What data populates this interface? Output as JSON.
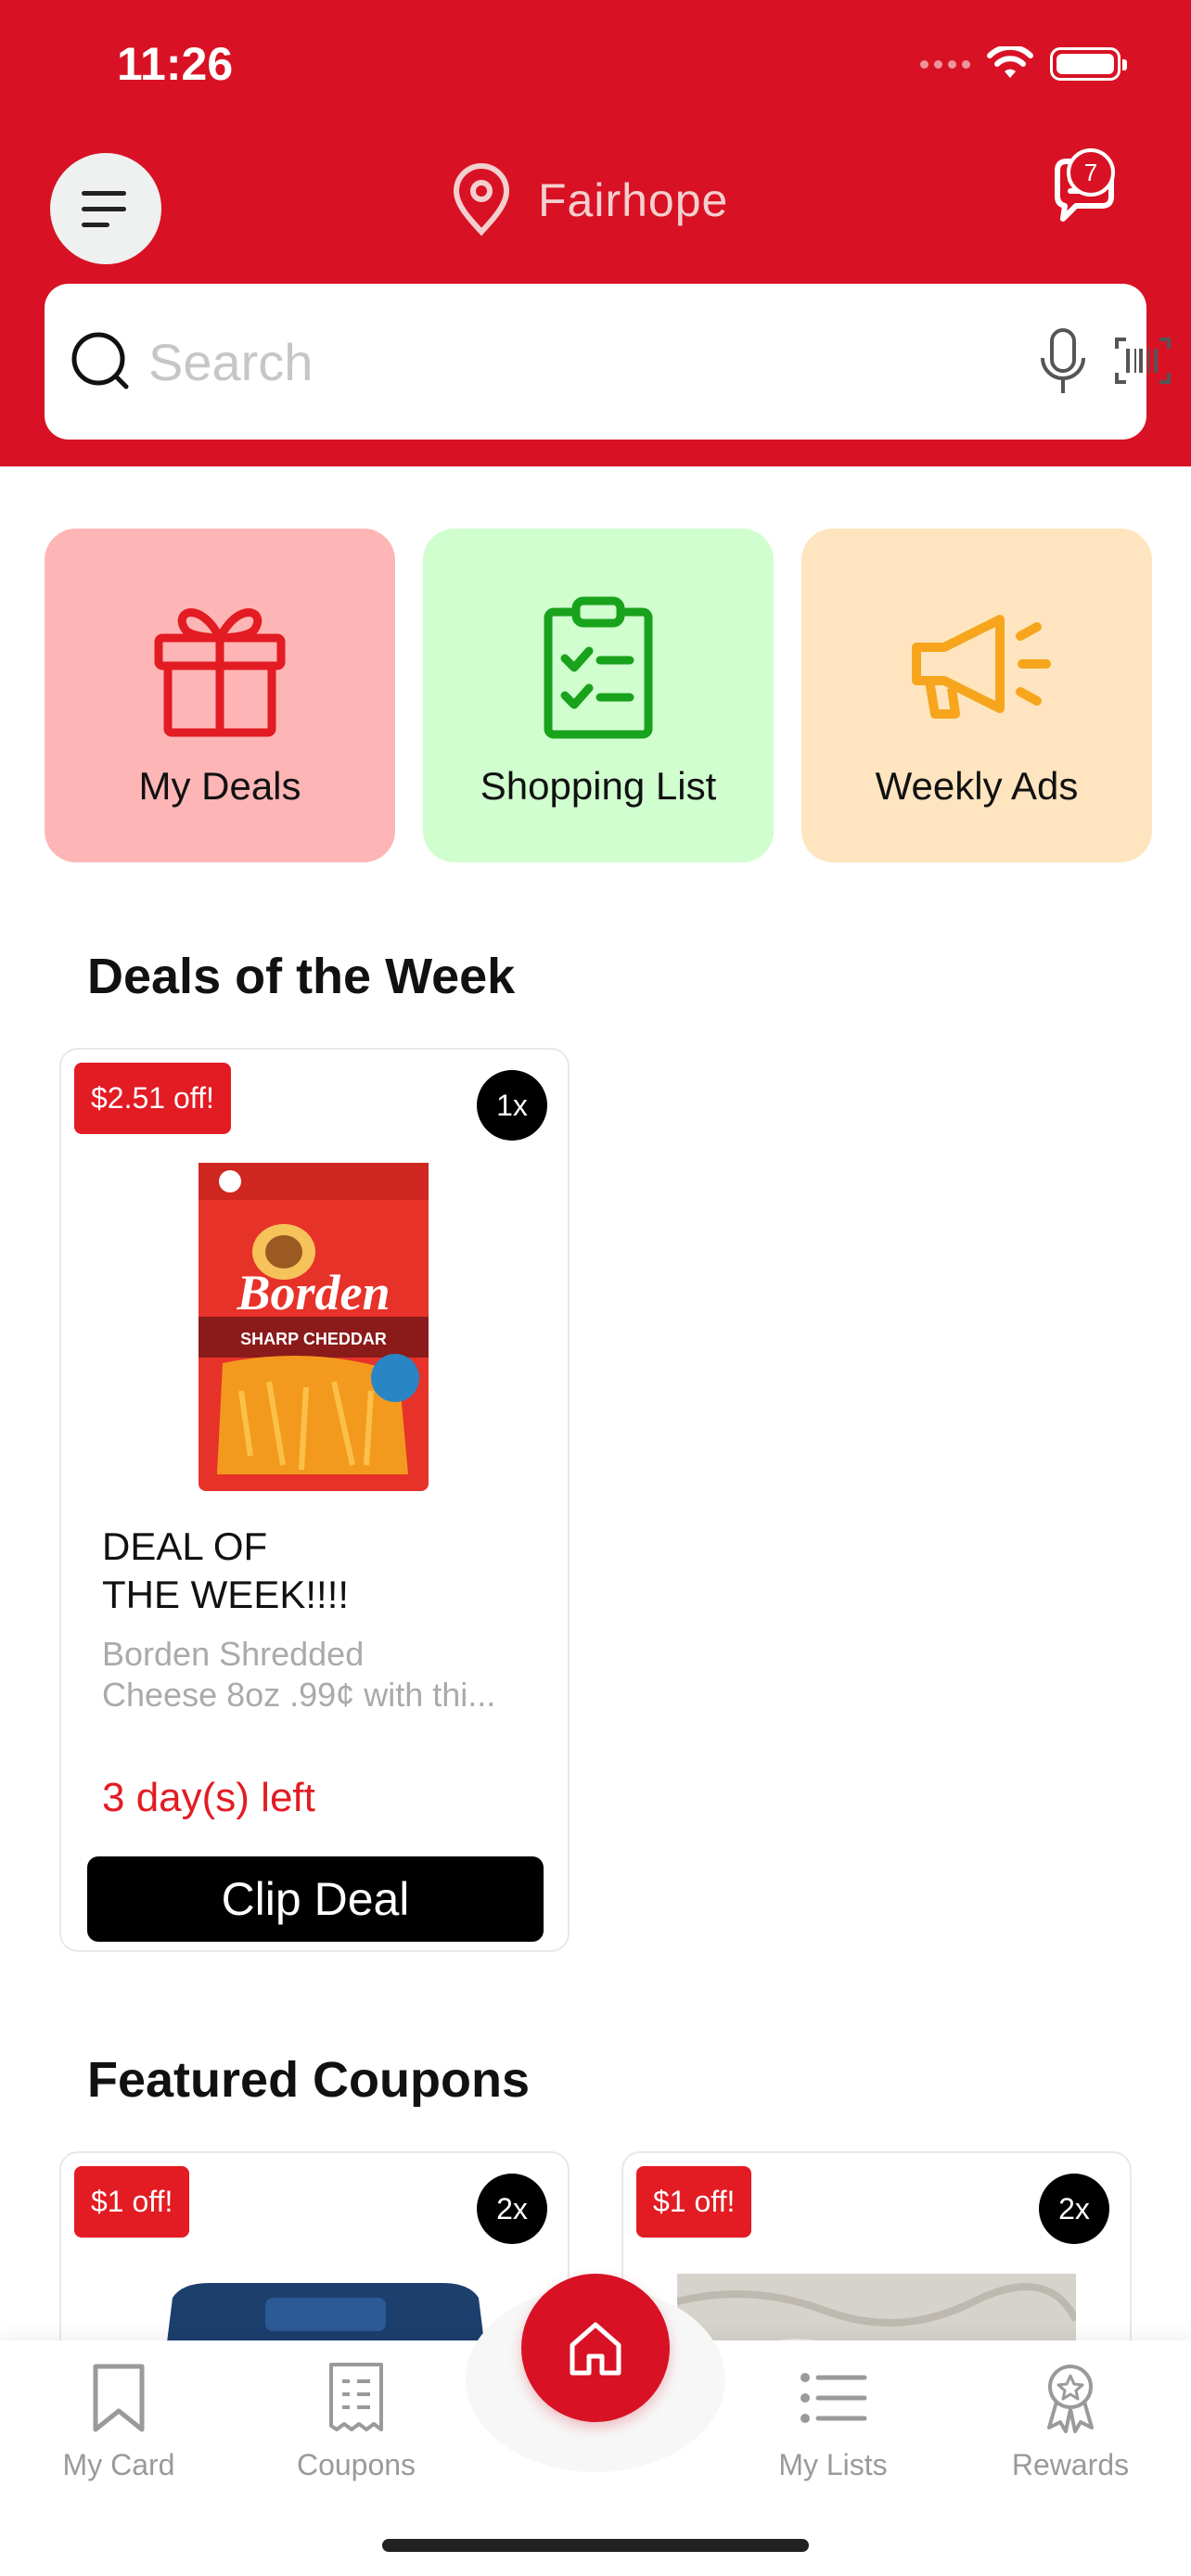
{
  "status": {
    "time": "11:26"
  },
  "header": {
    "location": "Fairhope",
    "messages_badge": "7",
    "search_placeholder": "Search"
  },
  "quick_tiles": [
    {
      "label": "My Deals",
      "icon": "gift-icon",
      "color": "#fdb6b5"
    },
    {
      "label": "Shopping List",
      "icon": "clipboard-check-icon",
      "color": "#d0fecf"
    },
    {
      "label": "Weekly Ads",
      "icon": "megaphone-icon",
      "color": "#fee5bf"
    }
  ],
  "deals_section": {
    "title": "Deals of the Week",
    "card": {
      "discount": "$2.51 off!",
      "quantity": "1x",
      "product_image": "Borden Sharp Cheddar shredded cheese bag",
      "title_line1": "DEAL OF",
      "title_line2": "THE WEEK!!!!",
      "description_line1": "Borden Shredded",
      "description_line2": "Cheese 8oz .99¢ with thi...",
      "days_left": "3 day(s) left",
      "button": "Clip Deal"
    }
  },
  "coupons_section": {
    "title": "Featured Coupons",
    "cards": [
      {
        "discount": "$1 off!",
        "quantity": "2x"
      },
      {
        "discount": "$1 off!",
        "quantity": "2x"
      }
    ]
  },
  "bottom_nav": {
    "items": [
      {
        "label": "My Card",
        "icon": "bookmark-icon"
      },
      {
        "label": "Coupons",
        "icon": "receipt-icon"
      },
      {
        "label": "My Lists",
        "icon": "list-icon"
      },
      {
        "label": "Rewards",
        "icon": "award-icon"
      }
    ],
    "home_icon": "home-icon"
  },
  "colors": {
    "brand_red": "#d81224",
    "discount_red": "#e31b23"
  }
}
